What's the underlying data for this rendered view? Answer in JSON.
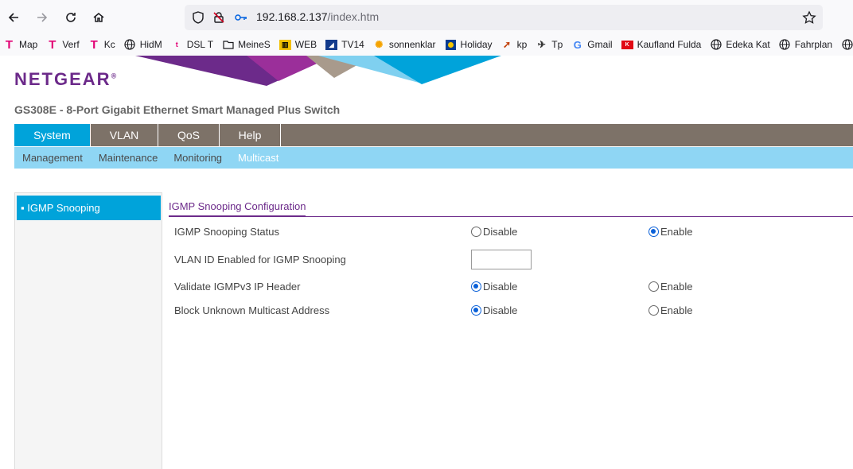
{
  "browser": {
    "url_host": "192.168.2.137",
    "url_path": "/index.htm"
  },
  "bookmarks": [
    {
      "label": "Map",
      "icon": "telekom-t-icon"
    },
    {
      "label": "Verf",
      "icon": "telekom-t-icon"
    },
    {
      "label": "Kc",
      "icon": "telekom-t-icon"
    },
    {
      "label": "HidM",
      "icon": "globe-icon"
    },
    {
      "label": "DSL T",
      "icon": "small-t-icon"
    },
    {
      "label": "MeineS",
      "icon": "folder-icon"
    },
    {
      "label": "WEB",
      "icon": "web-icon"
    },
    {
      "label": "TV14",
      "icon": "tv14-icon"
    },
    {
      "label": "sonnenklar",
      "icon": "sun-icon"
    },
    {
      "label": "Holiday",
      "icon": "holiday-icon"
    },
    {
      "label": "kp",
      "icon": "arrow-icon"
    },
    {
      "label": "Tp",
      "icon": "tp-icon"
    },
    {
      "label": "Gmail",
      "icon": "google-icon"
    },
    {
      "label": "Kaufland Fulda",
      "icon": "kaufland-icon"
    },
    {
      "label": "Edeka Kat",
      "icon": "globe-icon"
    },
    {
      "label": "Fahrplan",
      "icon": "globe-icon"
    }
  ],
  "logo": "NETGEAR",
  "product_title": "GS308E - 8-Port Gigabit Ethernet Smart Managed Plus Switch",
  "main_nav": [
    "System",
    "VLAN",
    "QoS",
    "Help"
  ],
  "sub_nav": [
    "Management",
    "Maintenance",
    "Monitoring",
    "Multicast"
  ],
  "sidebar": {
    "item": "▪ IGMP Snooping"
  },
  "section_title": "IGMP Snooping Configuration",
  "rows": {
    "status": {
      "label": "IGMP Snooping Status",
      "opt1": "Disable",
      "opt2": "Enable",
      "selected": "Enable"
    },
    "vlan": {
      "label": "VLAN ID Enabled for IGMP Snooping",
      "value": ""
    },
    "validate": {
      "label": "Validate IGMPv3 IP Header",
      "opt1": "Disable",
      "opt2": "Enable",
      "selected": "Disable"
    },
    "block": {
      "label": "Block Unknown Multicast Address",
      "opt1": "Disable",
      "opt2": "Enable",
      "selected": "Disable"
    }
  },
  "colors": {
    "brand_purple": "#6c2a8a",
    "active_blue": "#00a3da",
    "nav_gray": "#7d7268",
    "subnav_blue": "#8fd6f4"
  }
}
